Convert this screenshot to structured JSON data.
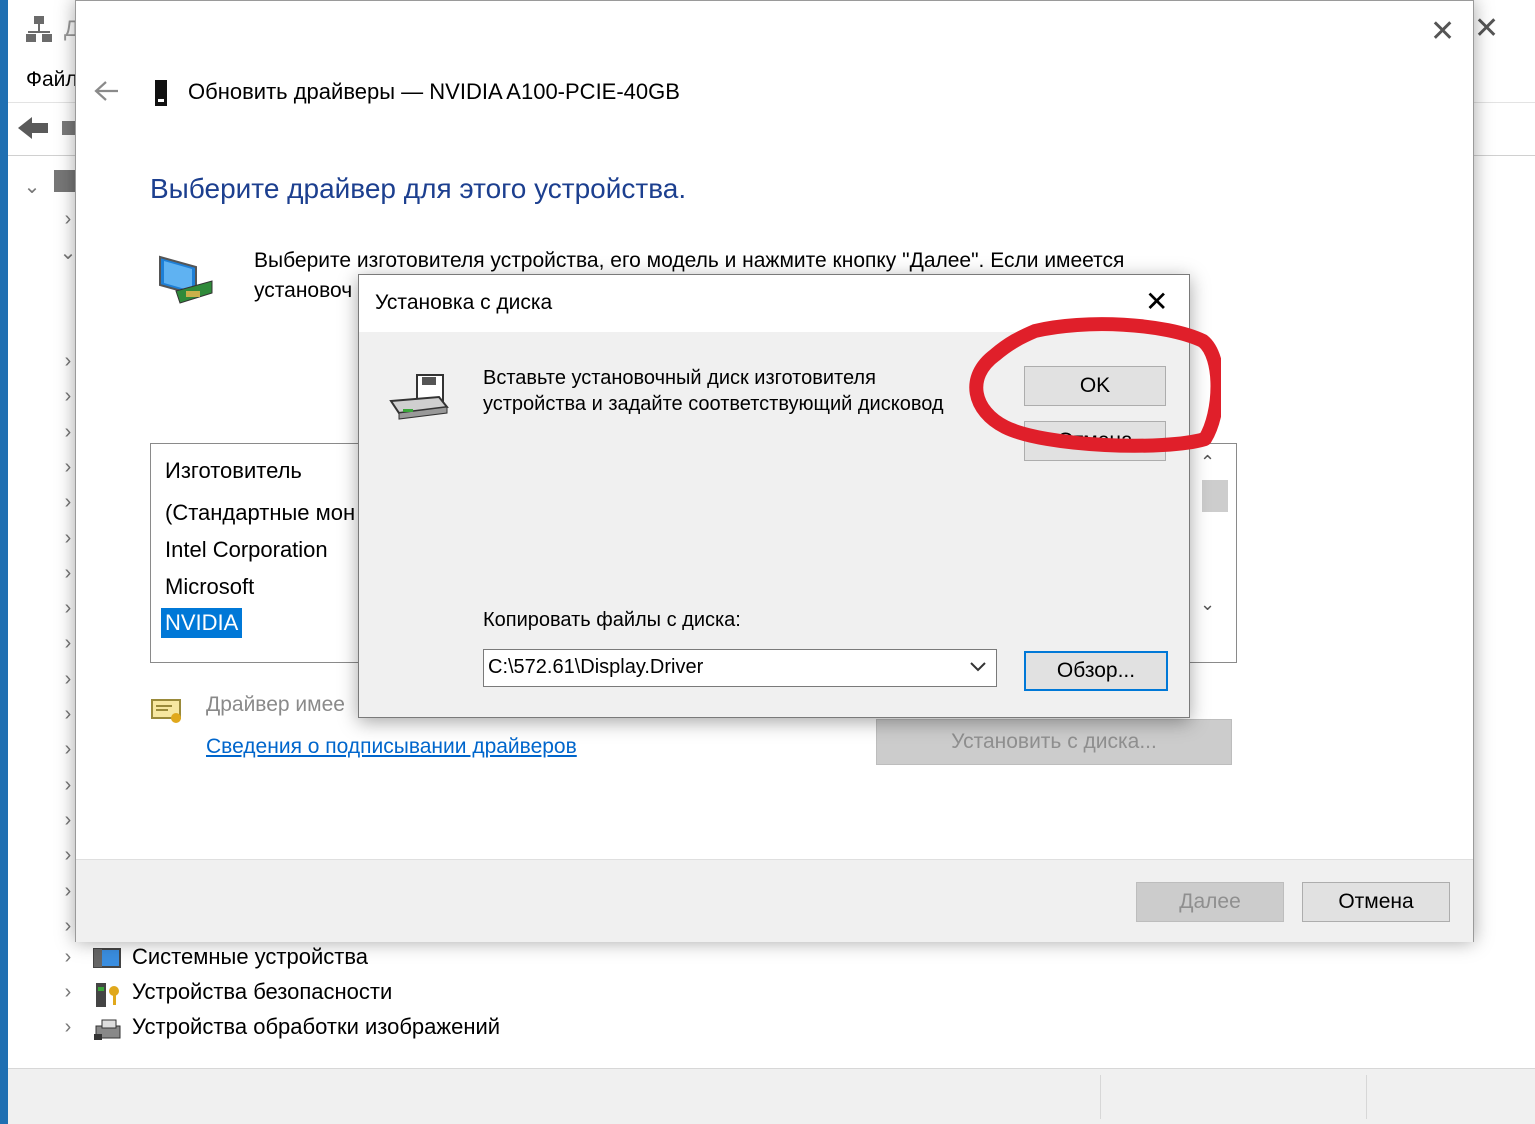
{
  "devmgr": {
    "title_fragment": "Д",
    "menu_file": "Файл",
    "tree_items": [
      {
        "label": "Системные устройства",
        "icon": "system-devices-icon"
      },
      {
        "label": "Устройства безопасности",
        "icon": "security-devices-icon"
      },
      {
        "label": "Устройства обработки изображений",
        "icon": "imaging-devices-icon"
      }
    ]
  },
  "wizard": {
    "title": "Обновить драйверы — NVIDIA A100-PCIE-40GB",
    "heading": "Выберите драйвер для этого устройства.",
    "instruction_line1": "Выберите изготовителя устройства, его модель и нажмите кнопку \"Далее\". Если имеется",
    "instruction_line2_fragment": "установоч",
    "manufacturer_header": "Изготовитель",
    "manufacturers": [
      "(Стандартные мон",
      "Intel Corporation",
      "Microsoft",
      "NVIDIA"
    ],
    "selected_manufacturer": "NVIDIA",
    "signed_text_fragment": "Драйвер имее",
    "signing_link": "Сведения о подписывании драйверов",
    "have_disk_button": "Установить с диска...",
    "next_button": "Далее",
    "cancel_button": "Отмена"
  },
  "disk_dialog": {
    "title": "Установка с диска",
    "message_line1": "Вставьте установочный диск изготовителя",
    "message_line2": "устройства и задайте соответствующий дисковод",
    "ok_button": "OK",
    "cancel_button": "Отмена",
    "copy_label": "Копировать файлы с диска:",
    "path_value": "C:\\572.61\\Display.Driver",
    "browse_button": "Обзор..."
  },
  "colors": {
    "heading": "#1c3f8f",
    "selection": "#0078d7",
    "link": "#0066cc",
    "annotation": "#e01f2a"
  }
}
